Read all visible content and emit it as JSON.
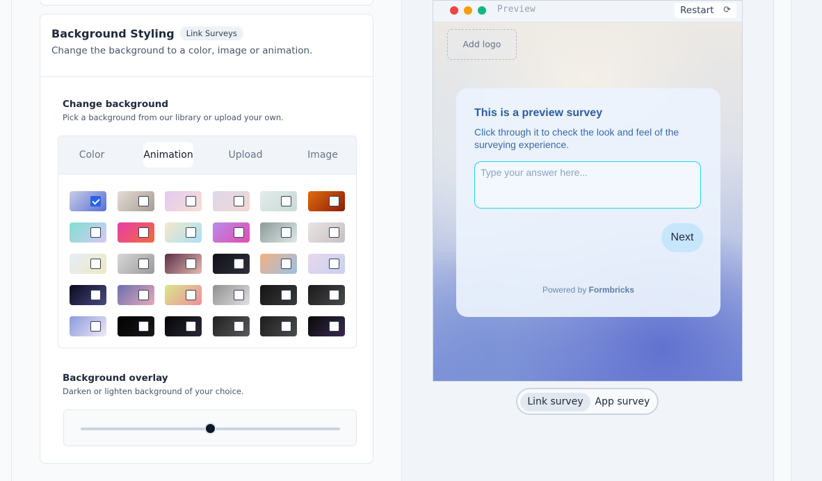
{
  "settings": {
    "card_title": "Background Styling",
    "badge": "Link Surveys",
    "card_subtitle": "Change the background to a color, image or animation.",
    "change_bg": {
      "title": "Change background",
      "description": "Pick a background from our library or upload your own."
    },
    "tabs": [
      {
        "label": "Color",
        "active": false
      },
      {
        "label": "Animation",
        "active": true
      },
      {
        "label": "Upload",
        "active": false
      },
      {
        "label": "Image",
        "active": false
      }
    ],
    "animations": {
      "selected_index": 0,
      "swatches": [
        [
          "#c5cde8",
          "#5a6fd0"
        ],
        [
          "#e4ddd5",
          "#a79c95"
        ],
        [
          "#e6c8f0",
          "#f4e0d4"
        ],
        [
          "#dcd8ec",
          "#f2d8d0"
        ],
        [
          "#e0ecea",
          "#c9d9d6"
        ],
        [
          "#e06a0e",
          "#8b1e08"
        ],
        [
          "#7ee0d0",
          "#d9c8f4"
        ],
        [
          "#e63ea8",
          "#f46a3c"
        ],
        [
          "#f6e8c8",
          "#a8e0f4"
        ],
        [
          "#b88ce8",
          "#e24cb0"
        ],
        [
          "#8a9a98",
          "#e0e8e6"
        ],
        [
          "#e8e4e4",
          "#c8c0c0"
        ],
        [
          "#e4eef8",
          "#f0e8c0"
        ],
        [
          "#d8d8d8",
          "#9a9a9a"
        ],
        [
          "#5a3048",
          "#e8b8b0"
        ],
        [
          "#101018",
          "#30303a"
        ],
        [
          "#f4b080",
          "#9ac0e8"
        ],
        [
          "#e8d8ec",
          "#c8d0f0"
        ],
        [
          "#0a0a20",
          "#4a4a80"
        ],
        [
          "#6a70b0",
          "#e8a8b8"
        ],
        [
          "#d8e888",
          "#f08ca0"
        ],
        [
          "#909090",
          "#e0e0e0"
        ],
        [
          "#141414",
          "#3a3a3a"
        ],
        [
          "#1a1a1a",
          "#4a4a4a"
        ],
        [
          "#8a9ae0",
          "#f0e8f4"
        ],
        [
          "#000000",
          "#1a1a1a"
        ],
        [
          "#050505",
          "#2a2a38"
        ],
        [
          "#202020",
          "#5a5a5a"
        ],
        [
          "#1c1c1c",
          "#4c4c4c"
        ],
        [
          "#0a0a0a",
          "#3a2a50"
        ]
      ]
    },
    "overlay": {
      "title": "Background overlay",
      "description": "Darken or lighten background of your choice.",
      "value_percent": 50
    }
  },
  "preview": {
    "label": "Preview",
    "restart_label": "Restart",
    "window_dots": [
      "#ef4444",
      "#f59e0b",
      "#10b981"
    ],
    "add_logo": "Add logo",
    "survey": {
      "title": "This is a preview survey",
      "subtitle": "Click through it to check the look and feel of the surveying experience.",
      "placeholder": "Type your answer here...",
      "next_label": "Next",
      "powered_prefix": "Powered by",
      "powered_brand": "Formbricks"
    },
    "toggle": [
      {
        "label": "Link survey",
        "active": true
      },
      {
        "label": "App survey",
        "active": false
      }
    ]
  }
}
